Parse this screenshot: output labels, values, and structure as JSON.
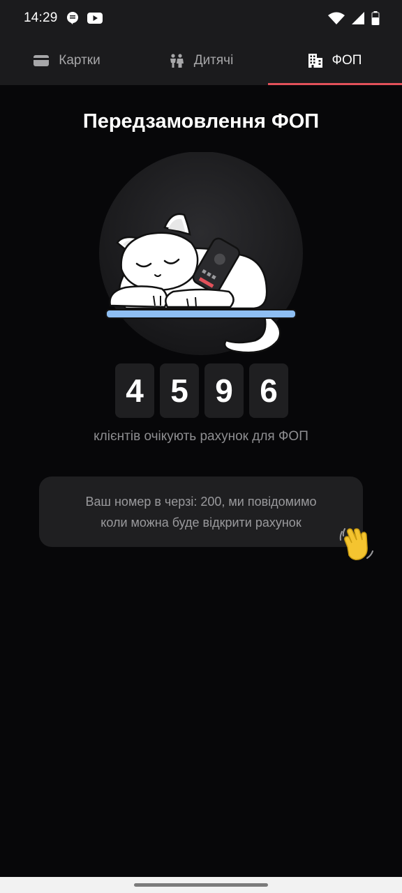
{
  "status_bar": {
    "time": "14:29"
  },
  "tabs": [
    {
      "label": "Картки",
      "icon": "card-icon",
      "active": false
    },
    {
      "label": "Дитячі",
      "icon": "children-icon",
      "active": false
    },
    {
      "label": "ФОП",
      "icon": "building-icon",
      "active": true
    }
  ],
  "main": {
    "title": "Передзамовлення ФОП",
    "counter_digits": [
      "4",
      "5",
      "9",
      "6"
    ],
    "counter_caption": "клієнтів очікують рахунок для ФОП",
    "queue_message_line1": "Ваш номер в черзі: 200, ми повідомимо",
    "queue_message_line2": "коли можна буде відкрити рахунок"
  },
  "colors": {
    "background": "#070709",
    "surface": "#1b1b1d",
    "card": "#1f1f21",
    "accent": "#e2515a",
    "shelf": "#8ebef2"
  }
}
